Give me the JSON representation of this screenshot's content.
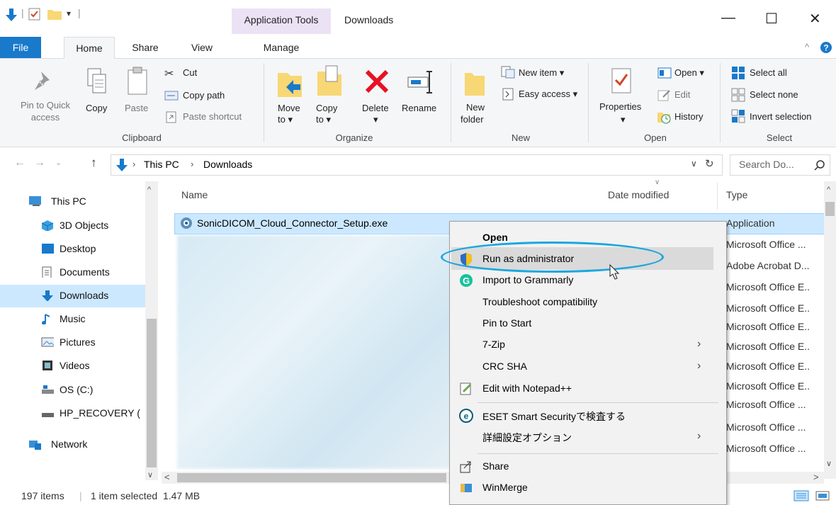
{
  "window": {
    "title": "Downloads",
    "context_tab_group": "Application Tools",
    "controls": {
      "minimize": "—",
      "maximize": "☐",
      "close": "✕"
    }
  },
  "tabs": [
    "File",
    "Home",
    "Share",
    "View",
    "Manage"
  ],
  "ribbon": {
    "clipboard": {
      "pin_l1": "Pin to Quick",
      "pin_l2": "access",
      "copy": "Copy",
      "paste": "Paste",
      "cut": "Cut",
      "copy_path": "Copy path",
      "paste_shortcut": "Paste shortcut",
      "label": "Clipboard"
    },
    "organize": {
      "move_l1": "Move",
      "move_l2": "to ▾",
      "copy_l1": "Copy",
      "copy_l2": "to ▾",
      "delete": "Delete",
      "delete_arrow": "▾",
      "rename": "Rename",
      "label": "Organize"
    },
    "new": {
      "new_folder_l1": "New",
      "new_folder_l2": "folder",
      "new_item": "New item ▾",
      "easy_access": "Easy access ▾",
      "label": "New"
    },
    "open": {
      "properties": "Properties",
      "properties_arrow": "▾",
      "open": "Open ▾",
      "edit": "Edit",
      "history": "History",
      "label": "Open"
    },
    "select": {
      "select_all": "Select all",
      "select_none": "Select none",
      "invert": "Invert selection",
      "label": "Select"
    }
  },
  "address": {
    "path_root": "This PC",
    "path_sep": "›",
    "path_leaf": "Downloads",
    "search_placeholder": "Search Do..."
  },
  "nav": {
    "items": [
      "This PC",
      "3D Objects",
      "Desktop",
      "Documents",
      "Downloads",
      "Music",
      "Pictures",
      "Videos",
      "OS (C:)",
      "HP_RECOVERY (",
      "Network"
    ],
    "selected": "Downloads"
  },
  "list": {
    "headers": {
      "name": "Name",
      "date": "Date modified",
      "type": "Type"
    },
    "selected_file": "SonicDICOM_Cloud_Connector_Setup.exe",
    "types": [
      "Application",
      "Microsoft Office ...",
      "Adobe Acrobat D...",
      "Microsoft Office E..",
      "Microsoft Office E..",
      "Microsoft Office E..",
      "Microsoft Office E..",
      "Microsoft Office E..",
      "Microsoft Office E..",
      "Microsoft Office ...",
      "Microsoft Office ...",
      "Microsoft Office ..."
    ]
  },
  "context_menu": {
    "items": [
      "Open",
      "Run as administrator",
      "Import to Grammarly",
      "Troubleshoot compatibility",
      "Pin to Start",
      "7-Zip",
      "CRC SHA",
      "Edit with Notepad++",
      "ESET Smart Securityで検査する",
      "詳細設定オプション",
      "Share",
      "WinMerge"
    ]
  },
  "status": {
    "items": "197 items",
    "selection": "1 item selected  1.47 MB"
  },
  "colors": {
    "accent": "#1979ca",
    "selection": "#cce8ff",
    "highlight_ring": "#1aa7e0",
    "context_tab": "#ece2f5"
  }
}
